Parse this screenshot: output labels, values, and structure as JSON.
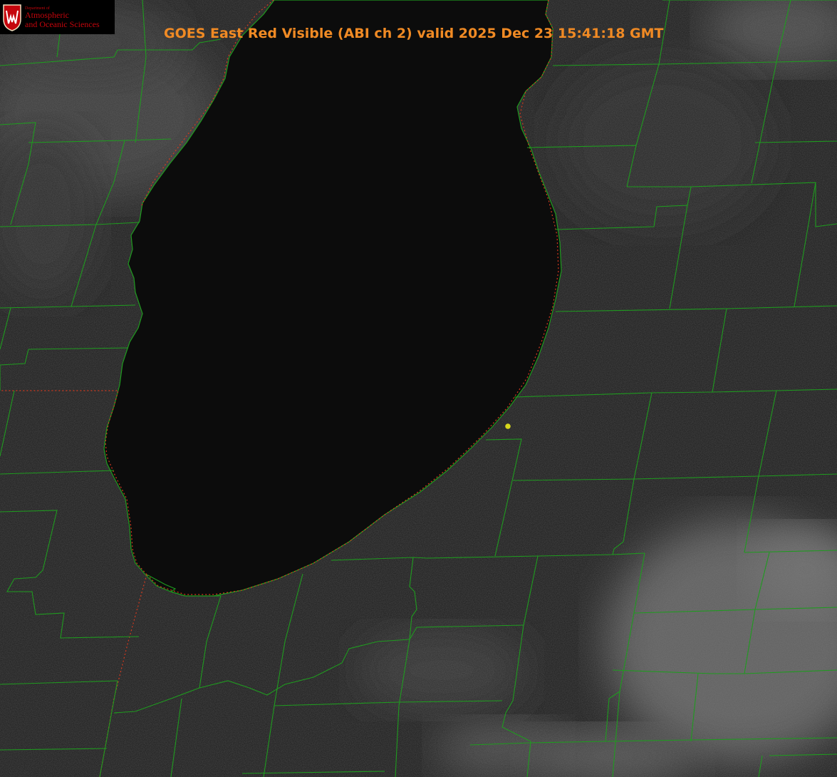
{
  "title": "GOES East Red Visible (ABI ch 2) valid 2025 Dec 23 15:41:18 GMT",
  "logo": {
    "department": "Department of",
    "line1": "Atmospheric",
    "line2": "and Oceanic Sciences"
  },
  "colors": {
    "title": "#f08a24",
    "county_borders": "#1f9b1f",
    "state_borders": "#d43a1f",
    "lake": "#0c0c0c",
    "marker": "#d8d81c",
    "logo_text": "#c5050c"
  }
}
